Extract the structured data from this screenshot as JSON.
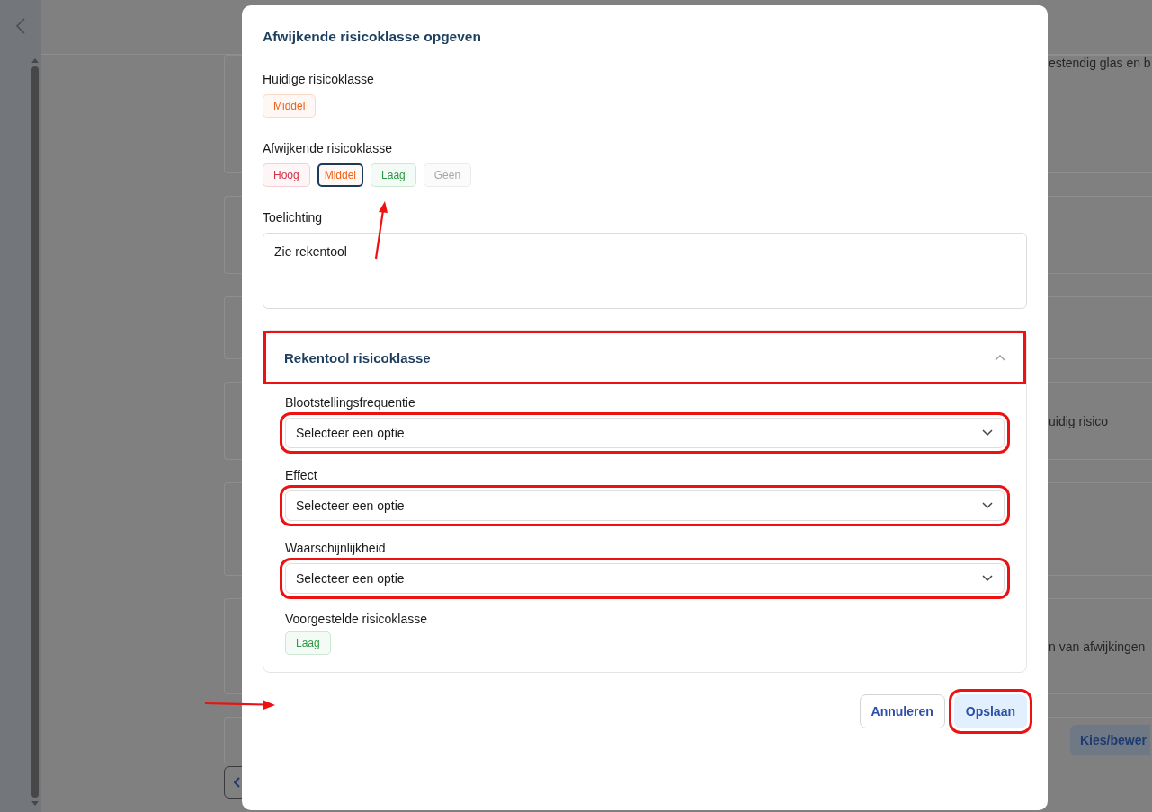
{
  "background": {
    "texts": [
      "estendig glas en b",
      "uidig risico",
      "n van afwijkingen"
    ],
    "button": "Kies/bewer"
  },
  "dialog": {
    "title": "Afwijkende risicoklasse opgeven",
    "current": {
      "label": "Huidige risicoklasse",
      "badge": {
        "text": "Middel",
        "color": "#f06018"
      }
    },
    "deviating": {
      "label": "Afwijkende risicoklasse",
      "options": [
        {
          "text": "Hoog",
          "color": "#d1344a",
          "selected": false
        },
        {
          "text": "Middel",
          "color": "#f06018",
          "selected": true
        },
        {
          "text": "Laag",
          "color": "#2e9a45",
          "selected": false
        },
        {
          "text": "Geen",
          "color": "#a8a8a8",
          "selected": false
        }
      ]
    },
    "explanation": {
      "label": "Toelichting",
      "value": "Zie rekentool"
    },
    "calculator": {
      "title": "Rekentool risicoklasse",
      "expanded": true,
      "highlighted": true,
      "fields": [
        {
          "label": "Blootstellingsfrequentie",
          "placeholder": "Selecteer een optie",
          "highlighted": true
        },
        {
          "label": "Effect",
          "placeholder": "Selecteer een optie",
          "highlighted": true
        },
        {
          "label": "Waarschijnlijkheid",
          "placeholder": "Selecteer een optie",
          "highlighted": true
        }
      ],
      "suggested": {
        "label": "Voorgestelde risicoklasse",
        "badge": {
          "text": "Laag",
          "color": "#2e9a45"
        }
      }
    },
    "buttons": [
      {
        "label": "Annuleren",
        "kind": "secondary",
        "highlighted": false
      },
      {
        "label": "Opslaan",
        "kind": "primary",
        "highlighted": true
      }
    ]
  }
}
